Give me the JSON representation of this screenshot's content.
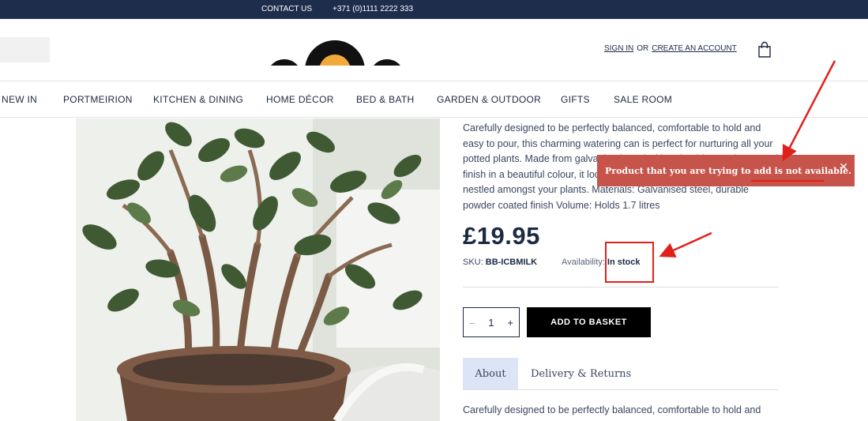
{
  "topbar": {
    "contact_label": "CONTACT US",
    "phone": "+371 (0)1111 2222 333"
  },
  "header": {
    "sign_in": "SIGN IN",
    "or_text": "OR",
    "create_account": "CREATE AN ACCOUNT"
  },
  "nav": {
    "items": [
      "NEW IN",
      "PORTMEIRION",
      "KITCHEN & DINING",
      "HOME DÉCOR",
      "BED & BATH",
      "GARDEN & OUTDOOR",
      "GIFTS",
      "SALE ROOM"
    ]
  },
  "product": {
    "description": "Carefully designed to be perfectly balanced, comfortable to hold and easy to pour, this charming watering can is perfect for nurturing all your potted plants. Made from galvanised steel with a durable powder-coated finish in a beautiful colour, it looks lovely placed on your windowsill or nestled amongst your plants. Materials: Galvanised steel, durable powder coated finish Volume: Holds 1.7 litres",
    "price": "£19.95",
    "sku_label": "SKU:",
    "sku": "BB-ICBMILK",
    "availability_label": "Availability:",
    "availability": "In stock",
    "quantity": "1",
    "minus": "–",
    "plus": "+",
    "add_to_basket": "ADD TO BASKET"
  },
  "tabs": {
    "about": "About",
    "delivery": "Delivery & Returns"
  },
  "tab_content": "Carefully designed to be perfectly balanced, comfortable to hold and",
  "toast": {
    "message": "Product that you are trying to add is not available.",
    "close": "✕"
  },
  "annotation_color": "#e0201b"
}
